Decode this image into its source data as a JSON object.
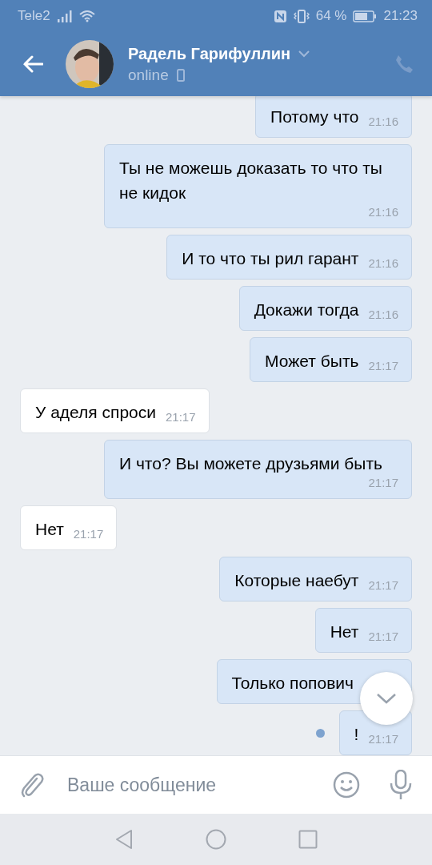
{
  "status_bar": {
    "carrier": "Tele2",
    "battery": "64 %",
    "time": "21:23"
  },
  "header": {
    "name": "Радель Гарифуллин",
    "status": "online"
  },
  "messages": [
    {
      "kind": "out",
      "text": "Потому что",
      "time": "21:16"
    },
    {
      "kind": "out",
      "text": "Ты не можешь доказать то что ты не кидок",
      "time": "21:16"
    },
    {
      "kind": "out",
      "text": "И то что ты рил гарант",
      "time": "21:16"
    },
    {
      "kind": "out",
      "text": "Докажи тогда",
      "time": "21:16"
    },
    {
      "kind": "out",
      "text": "Может быть",
      "time": "21:17"
    },
    {
      "kind": "in",
      "text": "У аделя спроси",
      "time": "21:17"
    },
    {
      "kind": "out",
      "text": "И что? Вы можете друзьями быть",
      "time": "21:17"
    },
    {
      "kind": "in",
      "text": "Нет",
      "time": "21:17"
    },
    {
      "kind": "out",
      "text": "Которые наебут",
      "time": "21:17"
    },
    {
      "kind": "out",
      "text": "Нет",
      "time": "21:17"
    },
    {
      "kind": "out",
      "text": "Только попович"
    },
    {
      "kind": "out",
      "text": "!",
      "time": "21:17",
      "unread": true
    }
  ],
  "composer": {
    "placeholder": "Ваше сообщение"
  }
}
